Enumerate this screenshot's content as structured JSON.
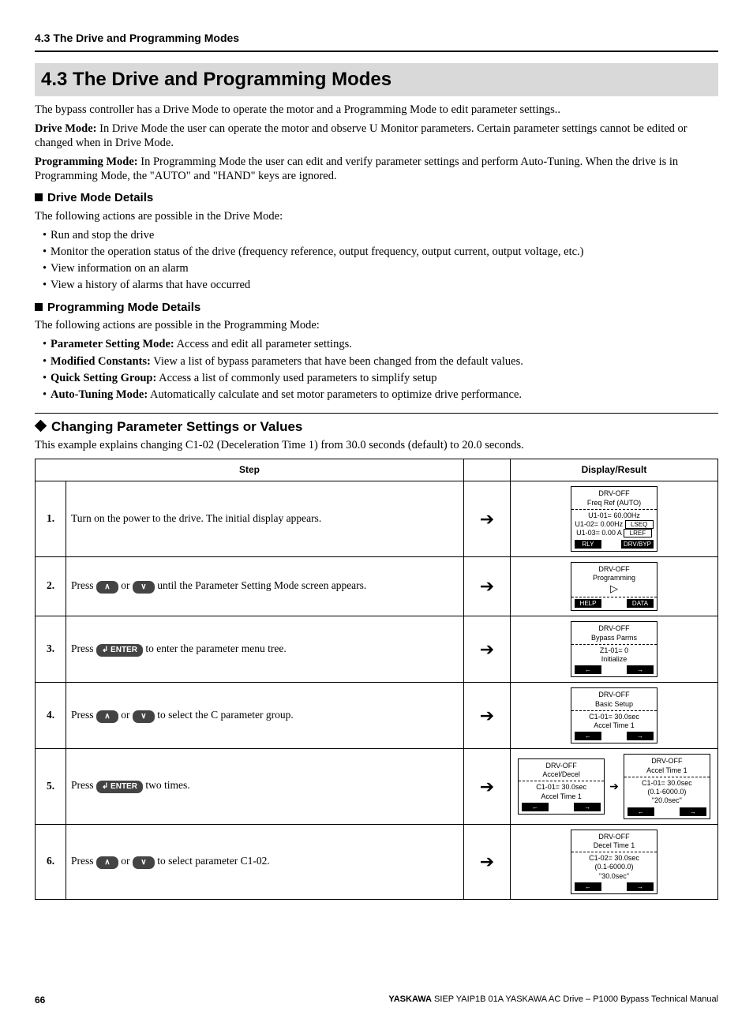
{
  "header": {
    "running": "4.3 The Drive and Programming Modes"
  },
  "title": "4.3   The Drive and Programming Modes",
  "intro": "The bypass controller has a Drive Mode to operate the motor and a Programming Mode to edit parameter settings..",
  "drive_mode_label": "Drive Mode:",
  "drive_mode_text": " In Drive Mode the user can operate the motor and observe U Monitor parameters. Certain parameter settings cannot be edited or changed when in Drive Mode.",
  "prog_mode_label": "Programming Mode:",
  "prog_mode_text": " In Programming Mode the user can edit and verify parameter settings and perform Auto-Tuning. When the drive is in Programming Mode, the \"AUTO\" and \"HAND\" keys are ignored.",
  "dm": {
    "head": "Drive Mode Details",
    "lead": "The following actions are possible in the Drive Mode:",
    "items": [
      "Run and stop the drive",
      "Monitor the operation status of the drive (frequency reference, output frequency, output current, output voltage, etc.)",
      "View information on an alarm",
      "View a history of alarms that have occurred"
    ]
  },
  "pm": {
    "head": "Programming Mode Details",
    "lead": "The following actions are possible in the Programming Mode:",
    "items": [
      {
        "b": "Parameter Setting Mode:",
        "t": " Access and edit all parameter settings."
      },
      {
        "b": "Modified Constants:",
        "t": " View a list of bypass parameters that have been changed from the default values."
      },
      {
        "b": "Quick Setting Group:",
        "t": " Access a list of commonly used parameters to simplify setup"
      },
      {
        "b": "Auto-Tuning Mode:",
        "t": " Automatically calculate and set motor parameters to optimize drive performance."
      }
    ]
  },
  "change": {
    "head": "Changing Parameter Settings or Values",
    "lead": "This example explains changing C1-02 (Deceleration Time 1) from 30.0 seconds (default) to 20.0 seconds."
  },
  "table": {
    "h_step": "Step",
    "h_disp": "Display/Result",
    "arrow": "➔",
    "up": "∧",
    "down": "∨",
    "enter": "↲ ENTER",
    "rows": [
      {
        "n": "1.",
        "text": "Turn on the power to the drive. The initial display appears."
      },
      {
        "n": "2.",
        "pre": "Press ",
        "k1": "up",
        "mid": " or ",
        "k2": "down",
        "post": " until the Parameter Setting Mode screen appears."
      },
      {
        "n": "3.",
        "pre": "Press ",
        "k1": "enter",
        "post": " to enter the parameter menu tree."
      },
      {
        "n": "4.",
        "pre": "Press ",
        "k1": "up",
        "mid": " or ",
        "k2": "down",
        "post": " to select the C parameter group."
      },
      {
        "n": "5.",
        "pre": "Press ",
        "k1": "enter",
        "post": " two times."
      },
      {
        "n": "6.",
        "pre": "Press ",
        "k1": "up",
        "mid": " or ",
        "k2": "down",
        "post": " to select parameter C1-02."
      }
    ],
    "disp": {
      "r1": {
        "l1": "DRV-OFF",
        "l2": "Freq Ref (AUTO)",
        "l3": "U1-01=  60.00Hz",
        "l4": "U1-02=  0.00Hz",
        "l4t": "LSEQ",
        "l5": "U1-03=  0.00 A",
        "l5t": "LREF",
        "fL": "RLY",
        "fR": "DRV/BYP"
      },
      "r2": {
        "l1": "DRV-OFF",
        "l2": "Programming",
        "icon": "▷",
        "fL": "HELP",
        "fR": "DATA"
      },
      "r3": {
        "l1": "DRV-OFF",
        "l2": "Bypass Parms",
        "l3": "Z1-01=   0",
        "l4": "Initialize",
        "fL": "←",
        "fR": "→"
      },
      "r4": {
        "l1": "DRV-OFF",
        "l2": "Basic Setup",
        "l3": "C1-01=   30.0sec",
        "l4": "Accel Time 1",
        "fL": "←",
        "fR": "→"
      },
      "r5a": {
        "l1": "DRV-OFF",
        "l2": "Accel/Decel",
        "l3": "C1-01=  30.0sec",
        "l4": "Accel Time 1",
        "fL": "←",
        "fR": "→"
      },
      "r5b": {
        "l1": "DRV-OFF",
        "l2": "Accel Time 1",
        "l3": "C1-01=   30.0sec",
        "l4": "(0.1-6000.0)",
        "l5": "\"20.0sec\"",
        "fL": "←",
        "fR": "→"
      },
      "r6": {
        "l1": "DRV-OFF",
        "l2": "Decel Time 1",
        "l3": "C1-02=   30.0sec",
        "l4": "(0.1-6000.0)",
        "l5": "\"30.0sec\"",
        "fL": "←",
        "fR": "→"
      }
    }
  },
  "footer": {
    "page": "66",
    "brand": "YASKAWA",
    "doc": " SIEP YAIP1B 01A YASKAWA AC Drive – P1000 Bypass Technical Manual"
  }
}
